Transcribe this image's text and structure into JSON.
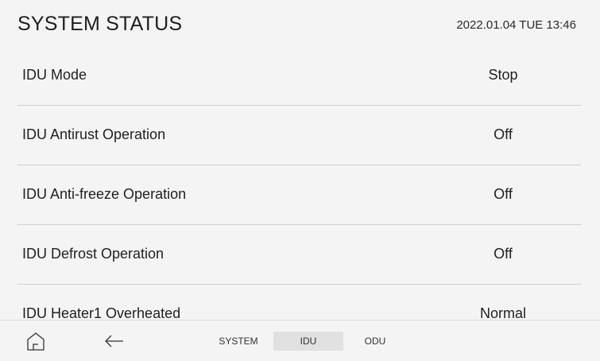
{
  "header": {
    "title": "SYSTEM STATUS",
    "datetime": "2022.01.04 TUE 13:46"
  },
  "status_rows": [
    {
      "label": "IDU Mode",
      "value": "Stop"
    },
    {
      "label": "IDU Antirust Operation",
      "value": "Off"
    },
    {
      "label": "IDU Anti-freeze Operation",
      "value": "Off"
    },
    {
      "label": "IDU Defrost Operation",
      "value": "Off"
    },
    {
      "label": "IDU Heater1 Overheated",
      "value": "Normal"
    }
  ],
  "nav": {
    "home_icon": "home-icon",
    "back_icon": "back-arrow-icon",
    "tabs": [
      {
        "label": "SYSTEM"
      },
      {
        "label": "IDU"
      },
      {
        "label": "ODU"
      }
    ],
    "active_tab": "IDU"
  }
}
